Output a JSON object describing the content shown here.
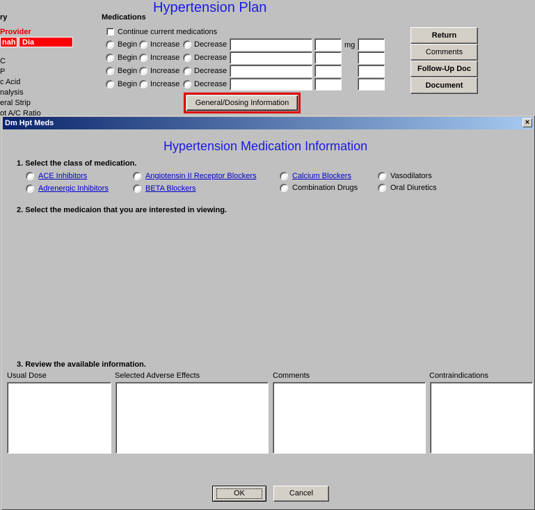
{
  "background_page": {
    "title": "Hypertension Plan",
    "left_header": "ry",
    "provider_label": "Provider",
    "provider_cells": [
      "nah",
      "Dia"
    ],
    "sidebar_items": [
      "C",
      "P",
      "c Acid",
      "nalysis",
      "eral Strip",
      "ot A/C Ratio"
    ],
    "medications": {
      "heading": "Medications",
      "continue_label": "Continue current medications",
      "continue_checked": false,
      "rows": [
        {
          "options": [
            "Begin",
            "Increase",
            "Decrease"
          ],
          "name_value": "",
          "dose_value": "",
          "unit": "mg",
          "extra_value": ""
        },
        {
          "options": [
            "Begin",
            "Increase",
            "Decrease"
          ],
          "name_value": "",
          "dose_value": "",
          "unit": "",
          "extra_value": ""
        },
        {
          "options": [
            "Begin",
            "Increase",
            "Decrease"
          ],
          "name_value": "",
          "dose_value": "",
          "unit": "",
          "extra_value": ""
        },
        {
          "options": [
            "Begin",
            "Increase",
            "Decrease"
          ],
          "name_value": "",
          "dose_value": "",
          "unit": "",
          "extra_value": ""
        }
      ],
      "general_dosing_button": "General/Dosing Information"
    },
    "right_buttons": [
      "Return",
      "Comments",
      "Follow-Up Doc",
      "Document"
    ],
    "highlight_color": "#e00000"
  },
  "dialog": {
    "window_title": "Dm Hpt Meds",
    "close_glyph": "✕",
    "heading": "Hypertension Medication Information",
    "step1": "1. Select the class of medication.",
    "classes": [
      {
        "label": "ACE Inhibitors",
        "link": true
      },
      {
        "label": "Adrenergic Inhibitors",
        "link": true
      },
      {
        "label": "Angiotensin II Receptor Blockers",
        "link": true
      },
      {
        "label": "BETA Blockers",
        "link": true
      },
      {
        "label": "Calcium Blockers",
        "link": true
      },
      {
        "label": "Combination Drugs",
        "link": false
      },
      {
        "label": "Vasodilators",
        "link": false
      },
      {
        "label": "Oral Diuretics",
        "link": false
      }
    ],
    "step2": "2. Select the medicaion that you are interested in viewing.",
    "step3": "3. Review the available information.",
    "info_boxes": [
      {
        "label": "Usual Dose",
        "value": ""
      },
      {
        "label": "Selected Adverse Effects",
        "value": ""
      },
      {
        "label": "Comments",
        "value": ""
      },
      {
        "label": "Contraindications",
        "value": ""
      }
    ],
    "ok_label": "OK",
    "cancel_label": "Cancel",
    "title_gradient": [
      "#0a246a",
      "#a6caf0"
    ],
    "heading_color": "#1a1ae6"
  }
}
